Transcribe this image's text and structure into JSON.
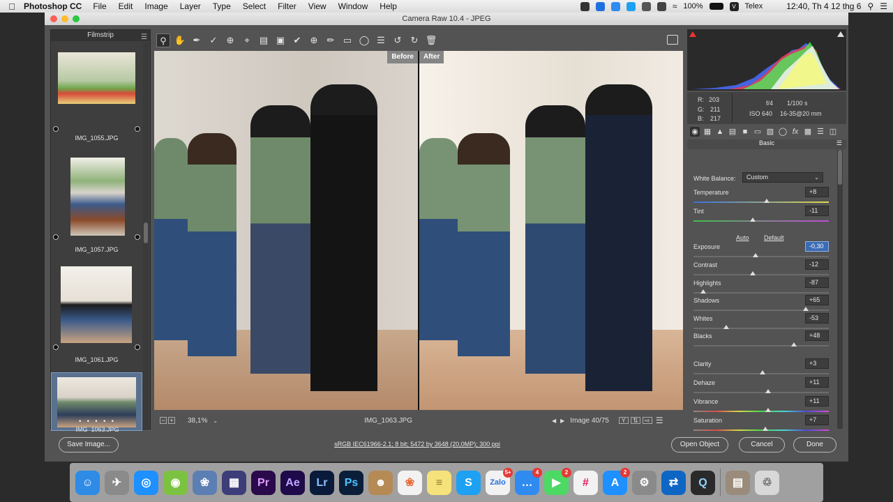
{
  "menubar": {
    "app_name": "Photoshop CC",
    "items": [
      "File",
      "Edit",
      "Image",
      "Layer",
      "Type",
      "Select",
      "Filter",
      "View",
      "Window",
      "Help"
    ],
    "battery": "100%",
    "input_method": "Telex",
    "clock": "12:40, Th 4 12 thg 6"
  },
  "window": {
    "title": "Camera Raw 10.4  -  JPEG"
  },
  "filmstrip": {
    "title": "Filmstrip",
    "items": [
      {
        "name": "IMG_1055.JPG",
        "selected": false
      },
      {
        "name": "IMG_1057.JPG",
        "selected": false
      },
      {
        "name": "IMG_1061.JPG",
        "selected": false
      },
      {
        "name": "IMG_1063.JPG",
        "selected": true,
        "rating": "• • • • •"
      }
    ]
  },
  "preview": {
    "before_label": "Before",
    "after_label": "After"
  },
  "statusbar": {
    "zoom": "38,1%",
    "filename": "IMG_1063.JPG",
    "image_counter": "Image 40/75"
  },
  "info": {
    "r_label": "R:",
    "r": "203",
    "g_label": "G:",
    "g": "211",
    "b_label": "B:",
    "b": "217",
    "aperture": "f/4",
    "shutter": "1/100 s",
    "iso": "ISO 640",
    "lens": "16-35@20 mm"
  },
  "basic": {
    "title": "Basic",
    "white_balance_label": "White Balance:",
    "white_balance_value": "Custom",
    "auto_label": "Auto",
    "default_label": "Default",
    "sliders": [
      {
        "label": "Temperature",
        "value": "+8",
        "level": 0.54,
        "gradient": "linear-gradient(90deg,#3a6fd9,#e2d84a)"
      },
      {
        "label": "Tint",
        "value": "-11",
        "level": 0.44,
        "gradient": "linear-gradient(90deg,#3fbf4a,#c24ad8)"
      },
      {
        "label": "Exposure",
        "value": "-0,30",
        "level": 0.46,
        "selected": true
      },
      {
        "label": "Contrast",
        "value": "-12",
        "level": 0.44
      },
      {
        "label": "Highlights",
        "value": "-87",
        "level": 0.07
      },
      {
        "label": "Shadows",
        "value": "+65",
        "level": 0.83
      },
      {
        "label": "Whites",
        "value": "-53",
        "level": 0.24
      },
      {
        "label": "Blacks",
        "value": "+48",
        "level": 0.74
      },
      {
        "label": "Clarity",
        "value": "+3",
        "level": 0.51
      },
      {
        "label": "Dehaze",
        "value": "+11",
        "level": 0.55
      },
      {
        "label": "Vibrance",
        "value": "+11",
        "level": 0.55,
        "gradient": "linear-gradient(90deg,#8a8a8a,#d94a4a,#d9d94a,#4ad94a,#4ad9d9,#4a4ad9,#d94ad9)"
      },
      {
        "label": "Saturation",
        "value": "+7",
        "level": 0.53,
        "gradient": "linear-gradient(90deg,#8a8a8a,#d94a4a,#d9d94a,#4ad94a,#4ad9d9,#4a4ad9,#d94ad9)"
      }
    ]
  },
  "bottom": {
    "save_label": "Save Image...",
    "workflow": "sRGB IEC61966-2.1; 8 bit; 5472 by 3648 (20,0MP); 300 ppi",
    "open_label": "Open Object",
    "cancel_label": "Cancel",
    "done_label": "Done"
  },
  "dock": {
    "items": [
      {
        "name": "finder",
        "color": "#2e8be6",
        "glyph": "☺"
      },
      {
        "name": "launchpad",
        "color": "#8a8a8a",
        "glyph": "✈"
      },
      {
        "name": "safari",
        "color": "#1e90ff",
        "glyph": "◎"
      },
      {
        "name": "coc-coc",
        "color": "#7cc242",
        "glyph": "◉"
      },
      {
        "name": "preview-app",
        "color": "#5b7fb3",
        "glyph": "❀"
      },
      {
        "name": "imovie",
        "color": "#3d3d7a",
        "glyph": "▦"
      },
      {
        "name": "premiere",
        "color": "#2a0a4a",
        "glyph": "Pr",
        "fg": "#e09cff"
      },
      {
        "name": "after-effects",
        "color": "#1f0a4a",
        "glyph": "Ae",
        "fg": "#c2a6ff"
      },
      {
        "name": "lightroom",
        "color": "#0a1a3a",
        "glyph": "Lr",
        "fg": "#8ec3ff"
      },
      {
        "name": "photoshop",
        "color": "#0a1e3a",
        "glyph": "Ps",
        "fg": "#4fc3ff"
      },
      {
        "name": "contacts",
        "color": "#b58a55",
        "glyph": "☻"
      },
      {
        "name": "photos",
        "color": "#f2f2f2",
        "glyph": "❀",
        "fg": "#e86a3a"
      },
      {
        "name": "notes",
        "color": "#f6e27a",
        "glyph": "≡",
        "fg": "#8a7a2a"
      },
      {
        "name": "skype",
        "color": "#1da1f2",
        "glyph": "S"
      },
      {
        "name": "zalo",
        "color": "#f2f2f2",
        "glyph": "Zalo",
        "fg": "#1f6fe0",
        "badge": "5+"
      },
      {
        "name": "messenger",
        "color": "#2f8bf0",
        "glyph": "…",
        "badge": "4"
      },
      {
        "name": "facetime",
        "color": "#4cd964",
        "glyph": "▶",
        "badge": "2"
      },
      {
        "name": "slack",
        "color": "#f2f2f2",
        "glyph": "#",
        "fg": "#e01e5a"
      },
      {
        "name": "app-store",
        "color": "#1e90ff",
        "glyph": "A",
        "badge": "2"
      },
      {
        "name": "system-preferences",
        "color": "#8a8a8a",
        "glyph": "⚙"
      },
      {
        "name": "teamviewer",
        "color": "#0e66c4",
        "glyph": "⇄"
      },
      {
        "name": "quicktime",
        "color": "#2a2a2a",
        "glyph": "Q",
        "fg": "#8fd3ff"
      },
      {
        "name": "downloads-stack",
        "color": "#9a8b7a",
        "glyph": "▤"
      },
      {
        "name": "trash",
        "color": "#d8d8d8",
        "glyph": "♲",
        "fg": "#666"
      }
    ]
  }
}
